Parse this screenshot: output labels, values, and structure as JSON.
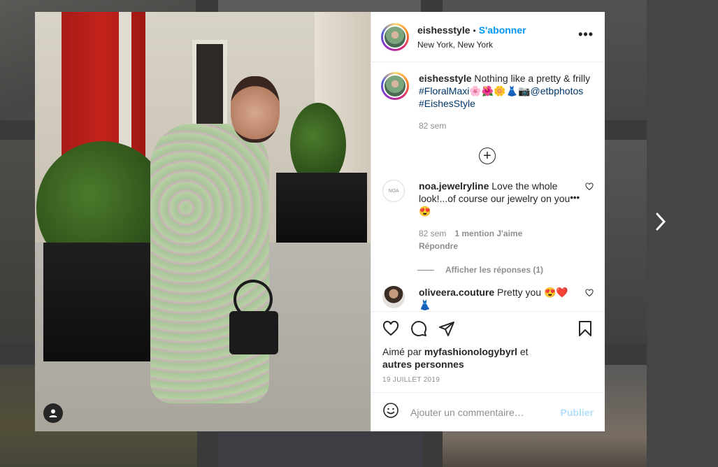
{
  "post": {
    "username": "eishesstyle",
    "follow_label": "S'abonner",
    "location": "New York, New York",
    "more_label": "•••"
  },
  "caption": {
    "username": "eishesstyle",
    "text": "Nothing like a pretty & frilly",
    "hashtag1": "#FloralMaxi",
    "emojis": "🌸🌺🌼👗📷",
    "mention": "@etbphotos",
    "hashtag2": "#EishesStyle",
    "age": "82 sem"
  },
  "load_more_icon": "plus-circle-icon",
  "comments": [
    {
      "username": "noa.jewelryline",
      "text": "Love the whole look!...of course our jewelry on you",
      "emoji": "😍",
      "age": "82 sem",
      "likes": "1 mention J'aime",
      "reply_label": "Répondre",
      "avatar_text": "NOA",
      "view_replies": "Afficher les réponses (1)"
    },
    {
      "username": "oliveera.couture",
      "text": "Pretty you",
      "emoji": "😍❤️👗"
    }
  ],
  "likes": {
    "prefix": "Aimé par",
    "user": "myfashionologybyrl",
    "mid": "et",
    "others": "autres personnes"
  },
  "date": "19 JUILLET 2019",
  "add_comment": {
    "placeholder": "Ajouter un commentaire…",
    "publish_label": "Publier"
  },
  "icons": {
    "like": "heart-icon",
    "comment": "comment-icon",
    "share": "share-icon",
    "save": "bookmark-icon",
    "emoji": "smiley-icon",
    "next": "chevron-right-icon",
    "user_tag": "user-icon"
  },
  "colors": {
    "link": "#0095f6",
    "hashtag": "#00376b",
    "muted": "#8e8e8e",
    "publish_disabled": "#b2dffc"
  }
}
